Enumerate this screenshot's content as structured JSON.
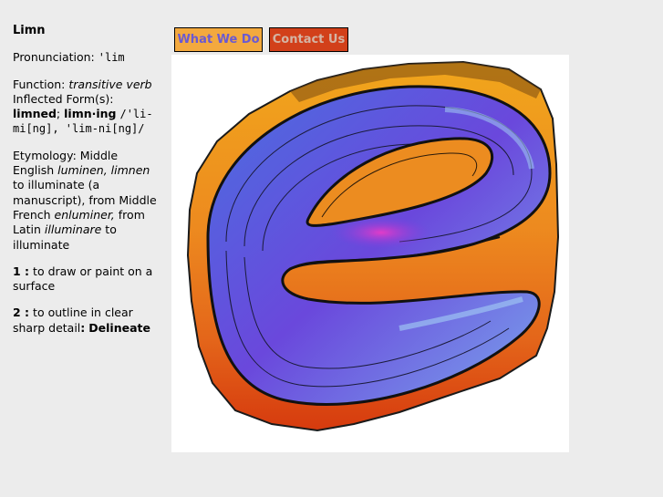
{
  "sidebar": {
    "title": "Limn",
    "pronunciation_label": "Pronunciation:",
    "pronunciation": "'lim",
    "function_label": "Function:",
    "function_value": "transitive verb",
    "inflected_label": "Inflected Form(s):",
    "form1": "limned",
    "sep1": ";",
    "form2": "limn·ing",
    "form2_pron": "/'li-mi[ng], 'lim-ni[ng]/",
    "etymology_label": "Etymology:",
    "etymology_text1": "Middle English",
    "etymology_italic1": "luminen, limnen",
    "etymology_text2": "to illuminate (a manuscript), from Middle French",
    "etymology_italic2": "enluminer,",
    "etymology_text3": "from Latin",
    "etymology_italic3": "illuminare",
    "etymology_text4": "to illuminate",
    "def1_num": "1 :",
    "def1_text": "to draw or paint on a surface",
    "def2_num": "2 :",
    "def2_text": "to outline in clear sharp detail",
    "def2_colon": ":",
    "def2_syn": "Delineate"
  },
  "nav": {
    "what_we_do": "What We Do",
    "contact_us": "Contact Us"
  },
  "logo": {
    "icon": "letter-e-logo-icon",
    "colors": {
      "orange_top": "#f0a020",
      "orange_mid": "#ec8a1e",
      "orange_bottom": "#dc3e10",
      "blue": "#5a82e6",
      "purple": "#6c3ee0",
      "magenta": "#d23ccc"
    }
  }
}
